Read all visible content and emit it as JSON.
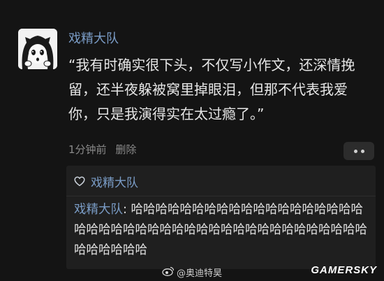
{
  "post": {
    "username": "戏精大队",
    "text": "“我有时确实很下头，不仅写小作文，还深情挽留，还半夜躲被窝里掉眼泪，但那不代表我爱你，只是我演得实在太过瘾了。”",
    "time": "1分钟前",
    "delete_label": "删除"
  },
  "reply": {
    "like_name": "戏精大队",
    "author": "戏精大队",
    "separator": ": ",
    "text": "哈哈哈哈哈哈哈哈哈哈哈哈哈哈哈哈哈哈哈哈哈哈哈哈哈哈哈哈哈哈哈哈哈哈哈哈哈哈哈哈哈哈哈哈哈哈哈哈哈"
  },
  "watermark": {
    "text": "@奥迪特昊",
    "icon": "weibo-icon"
  },
  "brand": {
    "text": "GAMERSKY"
  },
  "colors": {
    "background": "#141414",
    "username": "#7a9cc6",
    "reply_box": "#1f1f1f"
  }
}
